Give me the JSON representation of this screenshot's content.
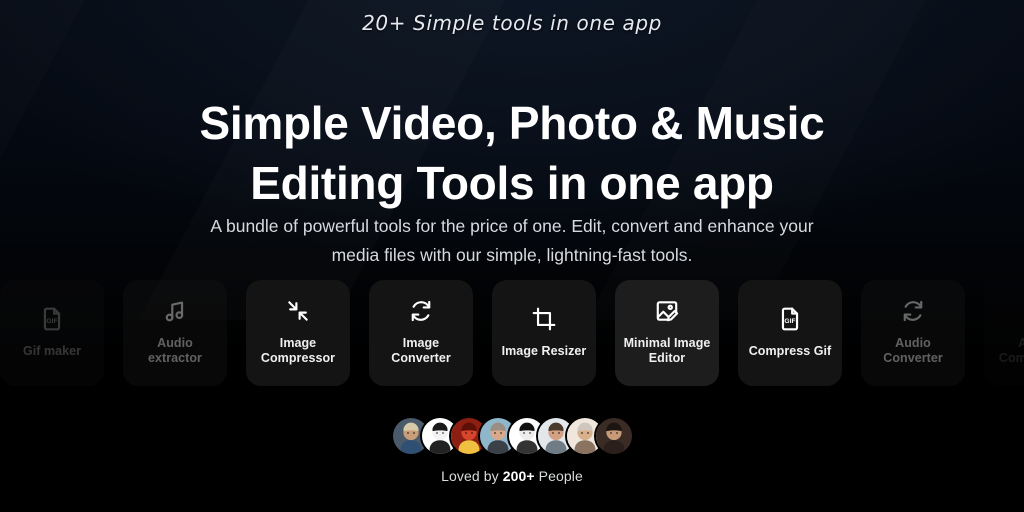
{
  "hero": {
    "tagline": "20+ Simple tools in one app",
    "heading_line1": "Simple Video, Photo & Music",
    "heading_line2": "Editing Tools in one app",
    "subhead_line1": "A bundle of powerful tools for the price of one. Edit, convert and enhance your",
    "subhead_line2": "media files with our simple, lightning-fast tools."
  },
  "social_proof": {
    "prefix": "Loved by ",
    "count": "200+",
    "suffix": " People",
    "avatars": [
      {
        "name": "avatar-1",
        "bg": "#4a5a6b",
        "skin": "#c99d7a",
        "hair": "#d8c9a8",
        "accent": "#2f4f73"
      },
      {
        "name": "avatar-2",
        "bg": "#ffffff",
        "skin": "#f2f2f2",
        "hair": "#1a1a1a",
        "accent": "#222222"
      },
      {
        "name": "avatar-3",
        "bg": "#8c1f12",
        "skin": "#d6452c",
        "hair": "#5e1008",
        "accent": "#f0c040"
      },
      {
        "name": "avatar-4",
        "bg": "#8fb7cc",
        "skin": "#d8a98a",
        "hair": "#9a8d82",
        "accent": "#3a3f48"
      },
      {
        "name": "avatar-5",
        "bg": "#ffffff",
        "skin": "#ededed",
        "hair": "#111111",
        "accent": "#333333"
      },
      {
        "name": "avatar-6",
        "bg": "#e3e7ea",
        "skin": "#d3a183",
        "hair": "#4a3a2e",
        "accent": "#6f7c86"
      },
      {
        "name": "avatar-7",
        "bg": "#efe6dd",
        "skin": "#d9b08c",
        "hair": "#cfc6bd",
        "accent": "#8a7461"
      },
      {
        "name": "avatar-8",
        "bg": "#3a2b25",
        "skin": "#c79a78",
        "hair": "#1b1410",
        "accent": "#2a1f1a"
      }
    ]
  },
  "tools": [
    {
      "label": "Gif maker",
      "icon": "gif-file-icon",
      "state": "faded-2"
    },
    {
      "label": "Audio extractor",
      "icon": "music-note-icon",
      "state": "faded-1"
    },
    {
      "label": "Image Compressor",
      "icon": "compress-icon",
      "state": "normal"
    },
    {
      "label": "Image Converter",
      "icon": "convert-sync-icon",
      "state": "normal"
    },
    {
      "label": "Image Resizer",
      "icon": "crop-icon",
      "state": "normal"
    },
    {
      "label": "Minimal Image Editor",
      "icon": "image-edit-icon",
      "state": "active"
    },
    {
      "label": "Compress Gif",
      "icon": "gif-file-icon",
      "state": "normal"
    },
    {
      "label": "Audio Converter",
      "icon": "convert-sync-icon",
      "state": "faded-1"
    },
    {
      "label": "Audio Compressor",
      "icon": "convert-sync-icon",
      "state": "faded-3"
    }
  ],
  "colors": {
    "background_top": "#050a13",
    "background_bottom": "#000000",
    "card_background": "#141414",
    "card_active_background": "#1d1d1d",
    "text_primary": "#ffffff",
    "text_secondary": "#d7dade"
  }
}
